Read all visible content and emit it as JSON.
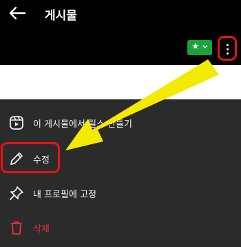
{
  "header": {
    "back_icon": "arrow-left-icon",
    "title": "게시물"
  },
  "toolbar": {
    "favorite_icon": "star-icon",
    "favorite_color": "#1aa33a",
    "more_icon": "vertical-dots-icon"
  },
  "menu": {
    "items": [
      {
        "label": "이 게시물에서 릴스 만들기",
        "icon": "reels-play-icon"
      },
      {
        "label": "수정",
        "icon": "pencil-icon"
      },
      {
        "label": "내 프로필에 고정",
        "icon": "pin-icon"
      },
      {
        "label": "삭제",
        "icon": "trash-icon",
        "color": "#ee2f39"
      }
    ]
  },
  "annotation": {
    "highlight_color": "#e11111",
    "arrow_color": "#f2ea00"
  }
}
